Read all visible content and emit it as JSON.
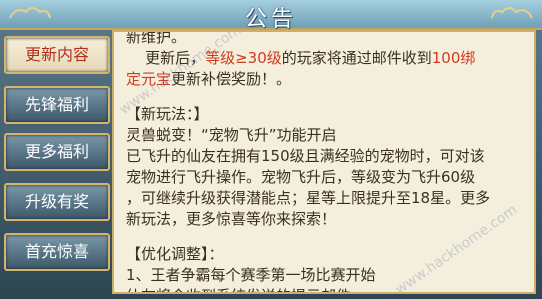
{
  "title": "公告",
  "sidebar": {
    "items": [
      {
        "label": "更新内容",
        "active": true
      },
      {
        "label": "先锋福利",
        "active": false
      },
      {
        "label": "更多福利",
        "active": false
      },
      {
        "label": "升级有奖",
        "active": false
      },
      {
        "label": "首充惊喜",
        "active": false
      }
    ]
  },
  "content": {
    "line1": "新维护。",
    "line2_a": "更新后，",
    "line2_b": "等级≥30级",
    "line2_c": "的玩家将通过邮件收到",
    "line2_d": "100绑",
    "line3_a": "定元宝",
    "line3_b": "更新补偿奖励！。",
    "section1_title": "【新玩法：】",
    "s1_line1": "灵兽蜕变！“宠物飞升”功能开启",
    "s1_line2": "已飞升的仙友在拥有150级且满经验的宠物时，可对该",
    "s1_line3": "宠物进行飞升操作。宠物飞升后，等级变为飞升60级",
    "s1_line4": "，可继续升级获得潜能点；星等上限提升至18星。更多",
    "s1_line5": "新玩法，更多惊喜等你来探索！",
    "section2_title": "【优化调整】：",
    "s2_line1": "1、王者争霸每个赛季第一场比赛开始",
    "s2_line2": "仙友将会收到系统发送的提示邮件"
  },
  "watermarks": [
    "www.hackhome.com",
    "www.hackhome.com"
  ],
  "colors": {
    "accent_red": "#d23a1e",
    "panel": "#f4eedc",
    "gold_border": "#cfae6a"
  }
}
